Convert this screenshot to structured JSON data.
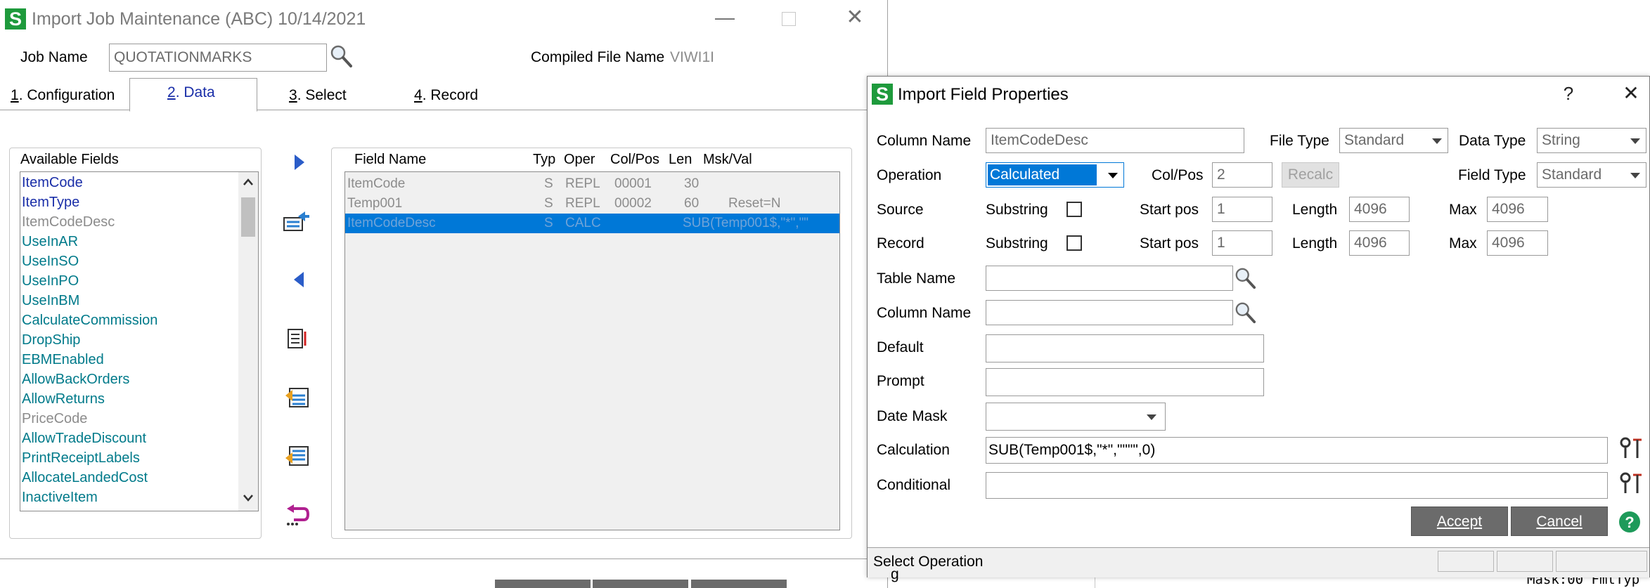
{
  "main_window": {
    "title": "Import Job Maintenance (ABC) 10/14/2021",
    "job_name_label": "Job Name",
    "job_name_value": "QUOTATIONMARKS",
    "compiled_label": "Compiled File Name",
    "compiled_value": "VIWI1I",
    "tabs": [
      {
        "num": "1",
        "rest": ". Configuration"
      },
      {
        "num": "2",
        "rest": ". Data"
      },
      {
        "num": "3",
        "rest": ". Select"
      },
      {
        "num": "4",
        "rest": ". Record"
      }
    ],
    "available_fields_label": "Available Fields",
    "available_fields": [
      "ItemCode",
      "ItemType",
      "ItemCodeDesc",
      "UseInAR",
      "UseInSO",
      "UseInPO",
      "UseInBM",
      "CalculateCommission",
      "DropShip",
      "EBMEnabled",
      "AllowBackOrders",
      "AllowReturns",
      "PriceCode",
      "AllowTradeDiscount",
      "PrintReceiptLabels",
      "AllocateLandedCost",
      "InactiveItem"
    ],
    "grid_headers": [
      "Field Name",
      "Typ",
      "Oper",
      "Col/Pos",
      "Len",
      "Msk/Val"
    ],
    "grid_rows": [
      {
        "name": "ItemCode",
        "typ": "S",
        "oper": "REPL",
        "colpos": "00001",
        "len": "30",
        "msk": ""
      },
      {
        "name": "Temp001",
        "typ": "S",
        "oper": "REPL",
        "colpos": "00002",
        "len": "60",
        "msk": "Reset=N"
      },
      {
        "name": "ItemCodeDesc",
        "typ": "S",
        "oper": "CALC",
        "colpos": "",
        "len": "",
        "msk": "SUB(Temp001$,\"*\",\"\""
      }
    ],
    "footer_bottom_text": "g"
  },
  "dialog": {
    "title": "Import Field Properties",
    "help_glyph": "?",
    "column_name_label": "Column Name",
    "column_name_value": "ItemCodeDesc",
    "file_type_label": "File Type",
    "file_type_value": "Standard",
    "data_type_label": "Data Type",
    "data_type_value": "String",
    "operation_label": "Operation",
    "operation_value": "Calculated",
    "colpos_label": "Col/Pos",
    "colpos_value": "2",
    "recalc_label": "Recalc",
    "field_type_label": "Field Type",
    "field_type_value": "Standard",
    "source_label": "Source",
    "record_label": "Record",
    "substring_label": "Substring",
    "start_pos_label": "Start pos",
    "source_start": "1",
    "record_start": "1",
    "length_label": "Length",
    "source_length": "4096",
    "record_length": "4096",
    "max_label": "Max",
    "source_max": "4096",
    "record_max": "4096",
    "table_name_label": "Table Name",
    "column_name2_label": "Column Name",
    "default_label": "Default",
    "prompt_label": "Prompt",
    "date_mask_label": "Date Mask",
    "calculation_label": "Calculation",
    "calculation_value": "SUB(Temp001$,\"*\",\"\"\"\",0)",
    "conditional_label": "Conditional",
    "accept_label": "Accept",
    "cancel_label": "Cancel",
    "status_text": "Select Operation"
  },
  "background_text": "Mask:00 FmtTyp"
}
